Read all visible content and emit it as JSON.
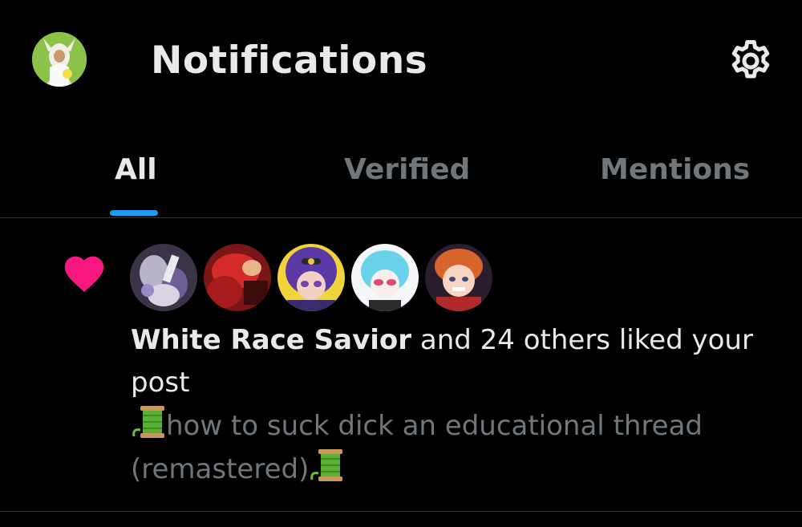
{
  "header": {
    "title": "Notifications"
  },
  "tabs": [
    {
      "label": "All",
      "active": true
    },
    {
      "label": "Verified",
      "active": false
    },
    {
      "label": "Mentions",
      "active": false
    }
  ],
  "notification": {
    "type_icon": "heart-icon",
    "actor_name": "White Race Savior",
    "action_text": " and 24 others liked your post",
    "post_preview_text": "how to suck dick an educational thread (remastered)",
    "preview_emoji": "thread-spool-icon"
  },
  "colors": {
    "background": "#000000",
    "primary_text": "#e7e9ea",
    "secondary_text": "#71767b",
    "accent": "#1d9bf0",
    "like_heart": "#f91880",
    "divider": "#2f3336"
  }
}
